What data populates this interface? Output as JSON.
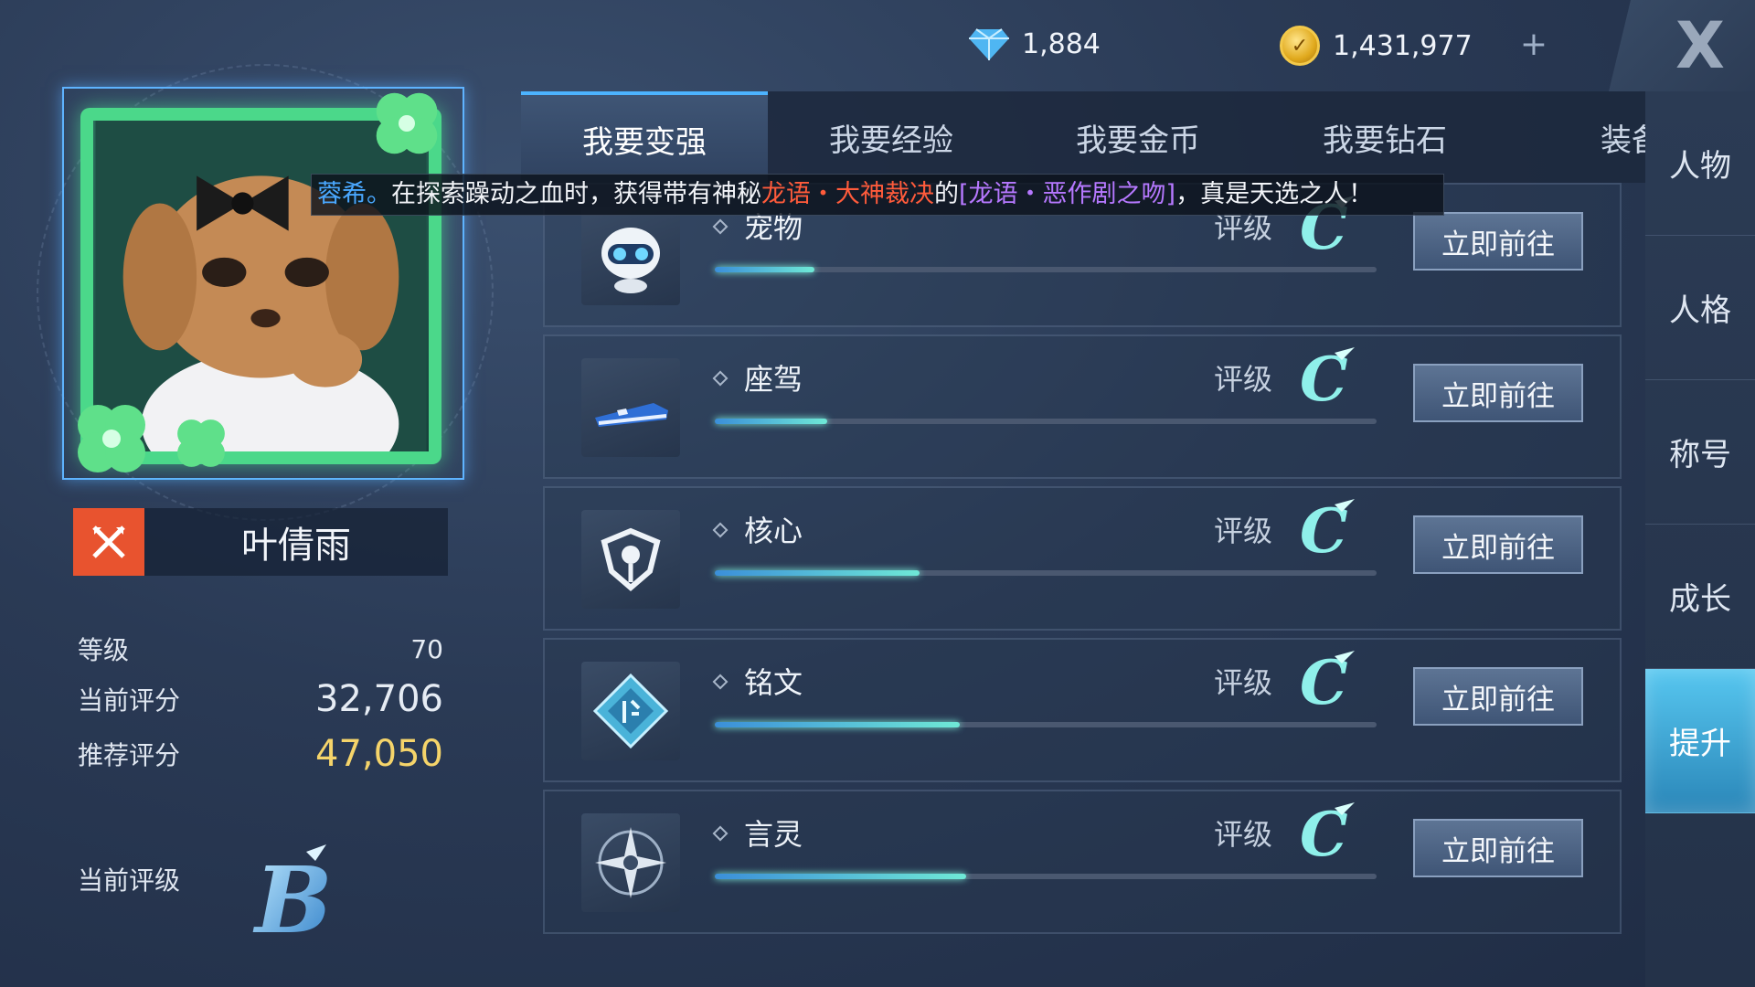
{
  "currency": {
    "diamonds": "1,884",
    "gold": "1,431,977",
    "plus": "+",
    "close": "X"
  },
  "player": {
    "name": "叶倩雨",
    "stats": [
      {
        "label": "等级",
        "value": "70"
      },
      {
        "label": "当前评分",
        "value": "32,706"
      },
      {
        "label": "推荐评分",
        "value": "47,050"
      }
    ],
    "rank_label": "当前评级",
    "rank": "B"
  },
  "tabs": [
    "我要变强",
    "我要经验",
    "我要金币",
    "我要钻石",
    "装备"
  ],
  "broadcast": {
    "name": "蓉希。",
    "text1": "在探索躁动之血时，获得带有神秘",
    "red": "龙语・大神裁决",
    "text2": "的",
    "purple": "[龙语・恶作剧之吻]",
    "text3": "，真是天选之人！"
  },
  "rows": [
    {
      "name": "宠物",
      "rate_label": "评级",
      "rate": "C",
      "progress": 0.15,
      "button": "立即前往",
      "icon": "pet-robot-icon"
    },
    {
      "name": "座驾",
      "rate_label": "评级",
      "rate": "C",
      "progress": 0.17,
      "button": "立即前往",
      "icon": "mount-hoverboard-icon"
    },
    {
      "name": "核心",
      "rate_label": "评级",
      "rate": "C",
      "progress": 0.31,
      "button": "立即前往",
      "icon": "core-emblem-icon"
    },
    {
      "name": "铭文",
      "rate_label": "评级",
      "rate": "C",
      "progress": 0.37,
      "button": "立即前往",
      "icon": "inscription-rune-icon"
    },
    {
      "name": "言灵",
      "rate_label": "评级",
      "rate": "C",
      "progress": 0.38,
      "button": "立即前往",
      "icon": "spirit-compass-icon"
    }
  ],
  "sidenav": [
    "人物",
    "人格",
    "称号",
    "成长",
    "提升"
  ],
  "colors": {
    "accent": "#4cb3ff",
    "score_gold": "#f5d46a",
    "frame_green": "#4bd88a",
    "class_badge": "#e8532f"
  }
}
